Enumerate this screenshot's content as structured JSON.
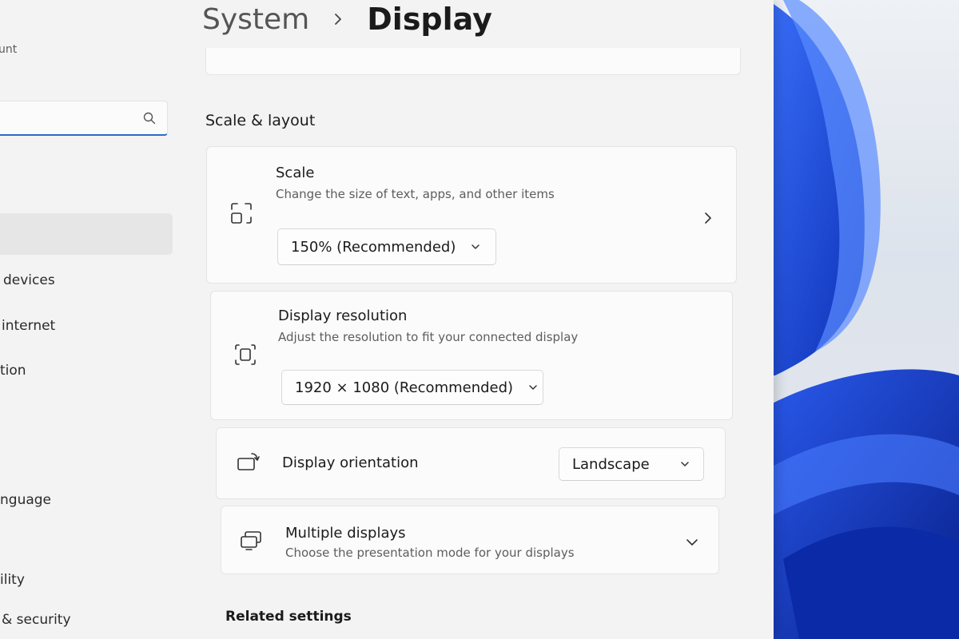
{
  "nav": {
    "account_fragment": "unt",
    "search_placeholder": "",
    "items": [
      "devices",
      "internet",
      "tion",
      "nguage",
      "ility",
      "& security"
    ]
  },
  "header": {
    "parent": "System",
    "current": "Display"
  },
  "sections": {
    "scale_layout": "Scale & layout",
    "related": "Related settings"
  },
  "scale": {
    "title": "Scale",
    "description": "Change the size of text, apps, and other items",
    "value": "150% (Recommended)"
  },
  "resolution": {
    "title": "Display resolution",
    "description": "Adjust the resolution to fit your connected display",
    "value": "1920 × 1080 (Recommended)"
  },
  "orientation": {
    "title": "Display orientation",
    "value": "Landscape"
  },
  "multiple": {
    "title": "Multiple displays",
    "description": "Choose the presentation mode for your displays"
  },
  "colors": {
    "accent": "#2e6bc6",
    "wallpaper_blue": "#1f4fd6"
  }
}
